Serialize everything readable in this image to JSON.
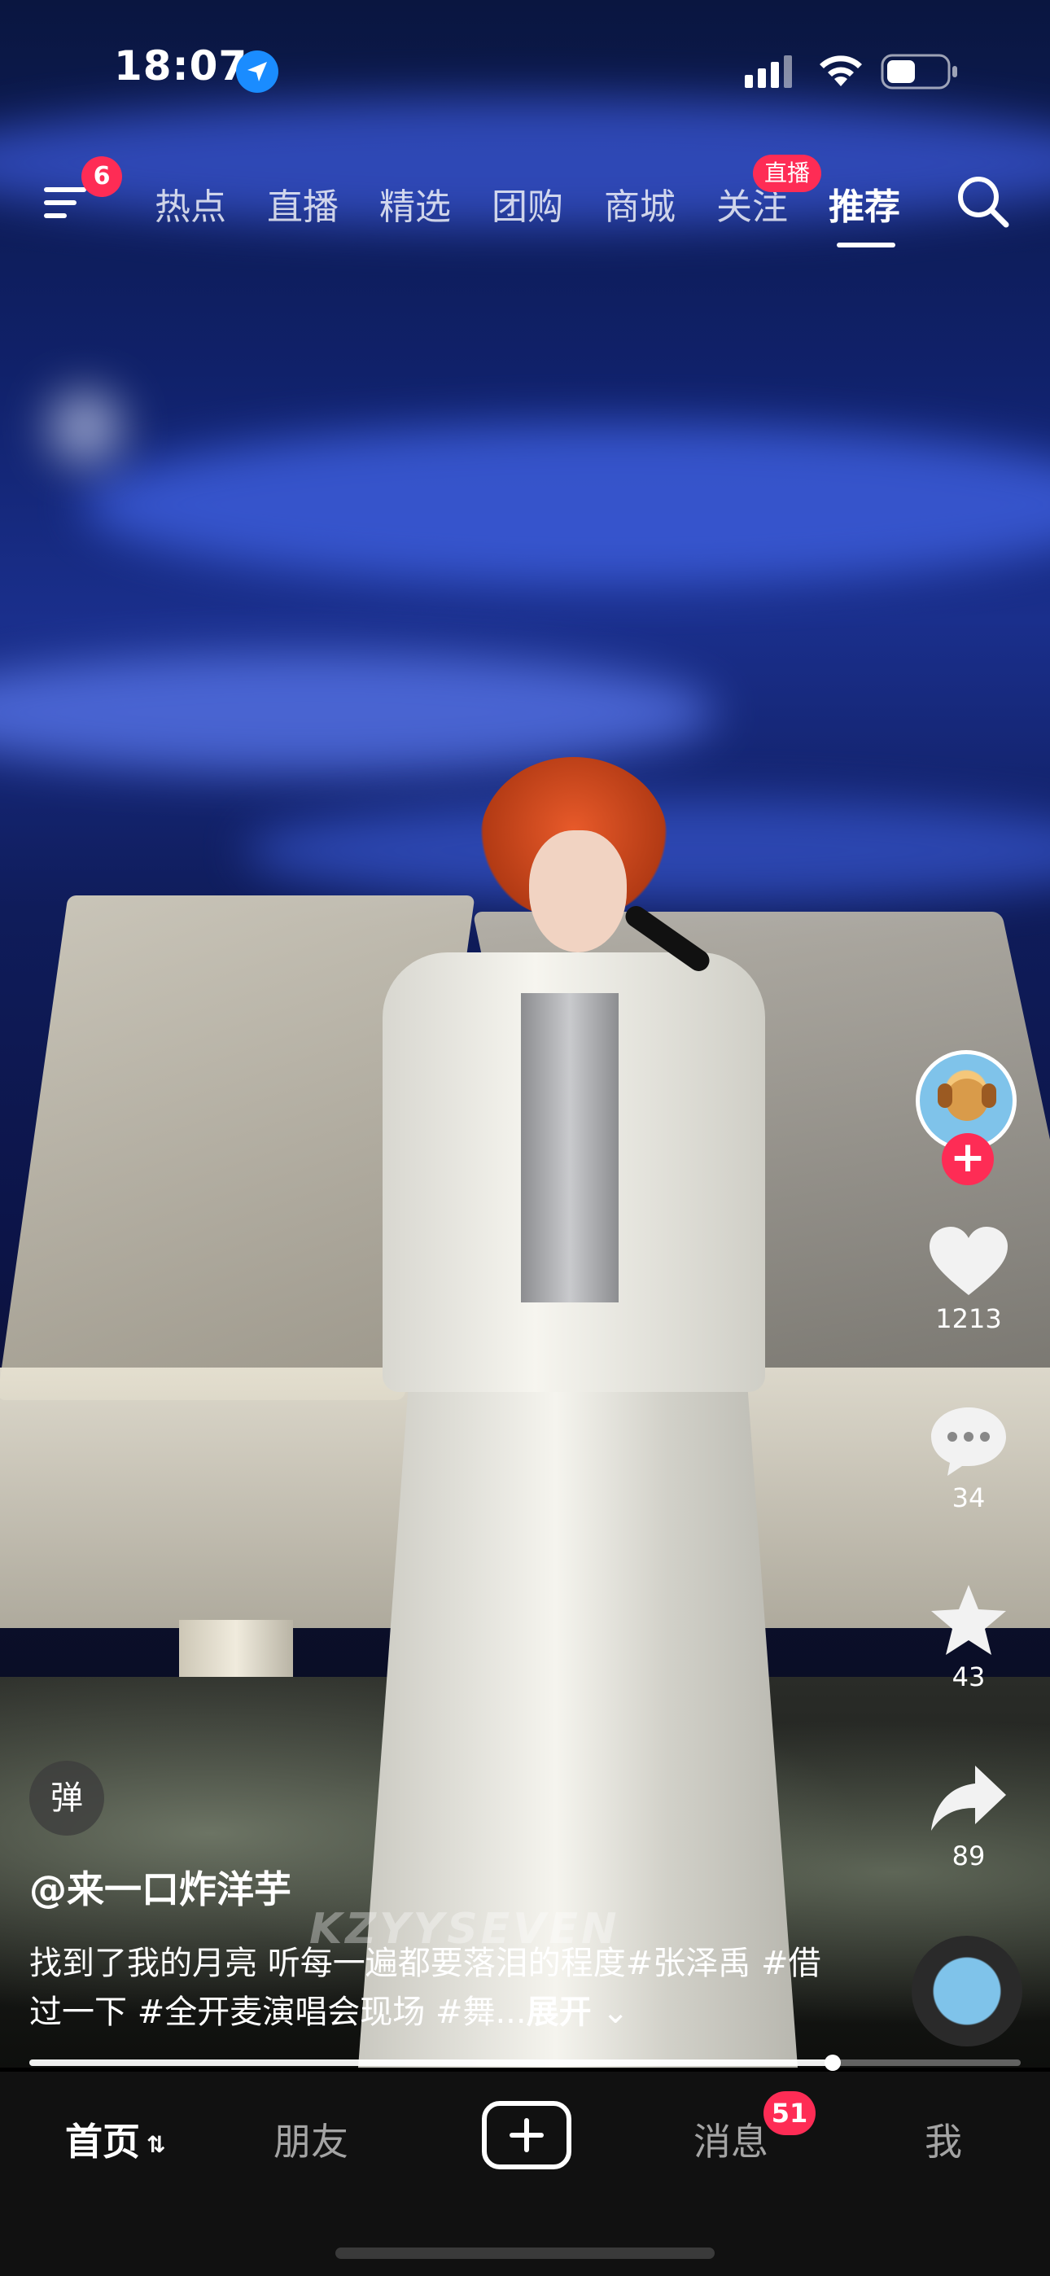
{
  "status_bar": {
    "time": "18:07"
  },
  "top_nav": {
    "menu_badge": "6",
    "tabs": [
      {
        "label": "热点"
      },
      {
        "label": "直播"
      },
      {
        "label": "精选"
      },
      {
        "label": "团购"
      },
      {
        "label": "商城"
      },
      {
        "label": "关注",
        "badge": "直播"
      },
      {
        "label": "推荐",
        "active": true
      }
    ]
  },
  "video": {
    "watermark": "KZYYSEVEN",
    "progress_fraction": 0.81
  },
  "right_rail": {
    "likes": "1213",
    "comments": "34",
    "favorites": "43",
    "shares": "89"
  },
  "caption": {
    "danmu_label": "弹",
    "author": "@来一口炸洋芋",
    "text": "找到了我的月亮 听每一遍都要落泪的程度#张泽禹 #借过一下  #全开麦演唱会现场 #舞...",
    "expand_label": "展开"
  },
  "bottom_nav": {
    "home": "首页",
    "home_swap": "⇅",
    "friends": "朋友",
    "messages": "消息",
    "messages_badge": "51",
    "me": "我"
  },
  "colors": {
    "accent_red": "#fe2c55",
    "bottom_bar": "#111111"
  }
}
